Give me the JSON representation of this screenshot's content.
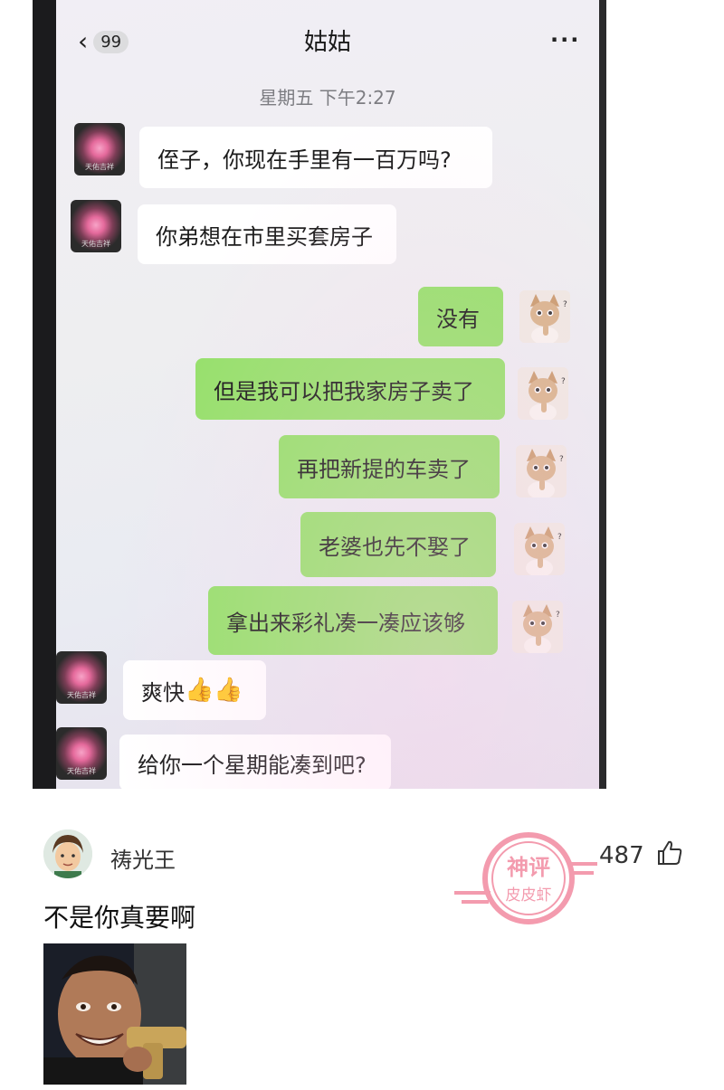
{
  "chat": {
    "back_badge": "99",
    "title": "姑姑",
    "more": "···",
    "timestamp": "星期五 下午2:27",
    "messages": [
      {
        "side": "left",
        "text": "侄子，你现在手里有一百万吗?"
      },
      {
        "side": "left",
        "text": "你弟想在市里买套房子"
      },
      {
        "side": "right",
        "text": "没有"
      },
      {
        "side": "right",
        "text": "但是我可以把我家房子卖了"
      },
      {
        "side": "right",
        "text": "再把新提的车卖了"
      },
      {
        "side": "right",
        "text": "老婆也先不娶了"
      },
      {
        "side": "right",
        "text": "拿出来彩礼凑一凑应该够"
      },
      {
        "side": "left",
        "text": "爽快",
        "emoji": "👍👍"
      },
      {
        "side": "left",
        "text": "给你一个星期能凑到吧?"
      }
    ],
    "avatar_caption": "天佑吉祥"
  },
  "comment": {
    "username": "祷光王",
    "likes": "487",
    "text": "不是你真要啊",
    "stamp_text_top": "神评",
    "stamp_text_bottom": "皮皮虾"
  },
  "colors": {
    "green_bubble": "#95e16a",
    "stamp": "#f07a93"
  }
}
